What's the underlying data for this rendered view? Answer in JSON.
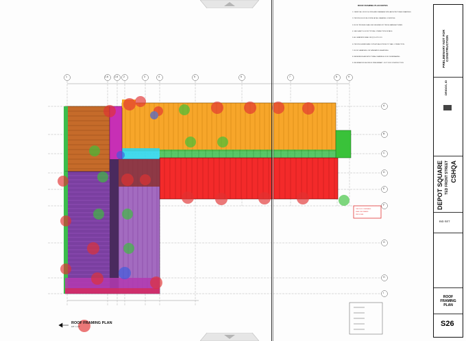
{
  "plan": {
    "title": "ROOF FRAMING PLAN",
    "scale": "1/8\" = 1'-0\""
  },
  "notes": {
    "title": "ROOF FRAMING PLAN NOTES",
    "items": [
      "1. VERIFY ALL ROOF SLOPES AND DRAINAGE WITH ARCHITECTURAL DRAWINGS.",
      "2. PROVIDE SOLID BLOCKING AT ALL BEARING LOCATIONS.",
      "3. ROOF TRUSSES SHALL BE DESIGNED BY TRUSS MANUFACTURER.",
      "4. SEE SHEET S-5 FOR TYPICAL CONNECTION DETAILS.",
      "5. ALL HEADERS SHALL BE (2) 2x12 U.N.O.",
      "6. PROVIDE HURRICANE CLIPS AT EACH TRUSS TO WALL CONNECTION.",
      "7. ROOF SHEATHING: 5/8\" APA RATED SHEATHING.",
      "8. REFERENCE ARCHITECTURAL DRAWINGS FOR OVERFRAMING.",
      "9. INFORMATION SHOWN IS PRELIMINARY - NOT FOR CONSTRUCTION."
    ]
  },
  "title_block": {
    "status": "PRELIMINARY NOT FOR CONSTRUCTION",
    "city": "DRIGGS, ID",
    "project_name": "DEPOT SQUARE",
    "project_address": "TED FRONT STREET",
    "firm": "CSHQA",
    "bid_set": "BID SET",
    "sheet_title": "ROOF FRAMING PLAN",
    "sheet_number": "S26"
  },
  "grid": {
    "columns": [
      "1",
      "1.6",
      "1.8",
      "2",
      "3",
      "4",
      "5",
      "6",
      "7",
      "8",
      "9"
    ],
    "rows": [
      "A",
      "B",
      "C",
      "D",
      "E",
      "F",
      "G",
      "H",
      "I"
    ]
  },
  "colors": {
    "orange_zone": "#f5a623",
    "red_zone": "#f22a2a",
    "purple_zone": "#7a3fa0",
    "green_band": "#3ab84a",
    "cyan_band": "#2fd3e6",
    "brown_zone": "#a0552a",
    "magenta_zone": "#c72fb5",
    "marker_red": "#e23232",
    "marker_blue": "#3a5de0",
    "marker_green": "#3ac23a"
  }
}
